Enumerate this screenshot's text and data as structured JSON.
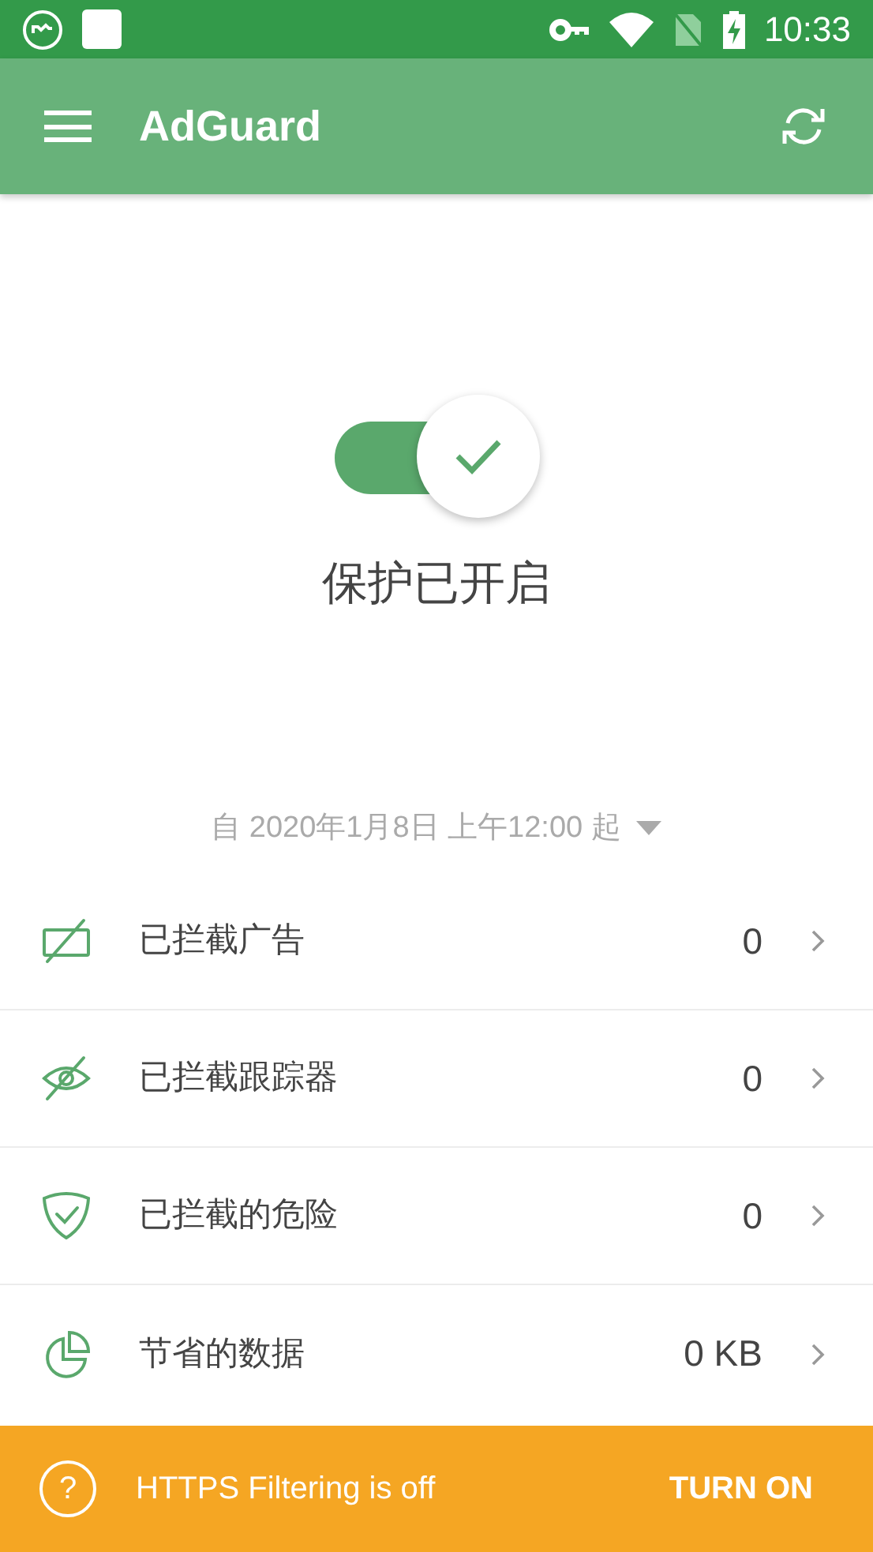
{
  "status_bar": {
    "time": "10:33"
  },
  "app_bar": {
    "title": "AdGuard"
  },
  "protection": {
    "on": true,
    "label": "保护已开启"
  },
  "period": {
    "label": "自 2020年1月8日 上午12:00 起"
  },
  "stats": [
    {
      "kind": "ads",
      "label": "已拦截广告",
      "value": "0"
    },
    {
      "kind": "trackers",
      "label": "已拦截跟踪器",
      "value": "0"
    },
    {
      "kind": "threats",
      "label": "已拦截的危险",
      "value": "0"
    },
    {
      "kind": "data",
      "label": "节省的数据",
      "value": "0 KB"
    }
  ],
  "banner": {
    "icon": "?",
    "text": "HTTPS Filtering is off",
    "action": "TURN ON"
  }
}
